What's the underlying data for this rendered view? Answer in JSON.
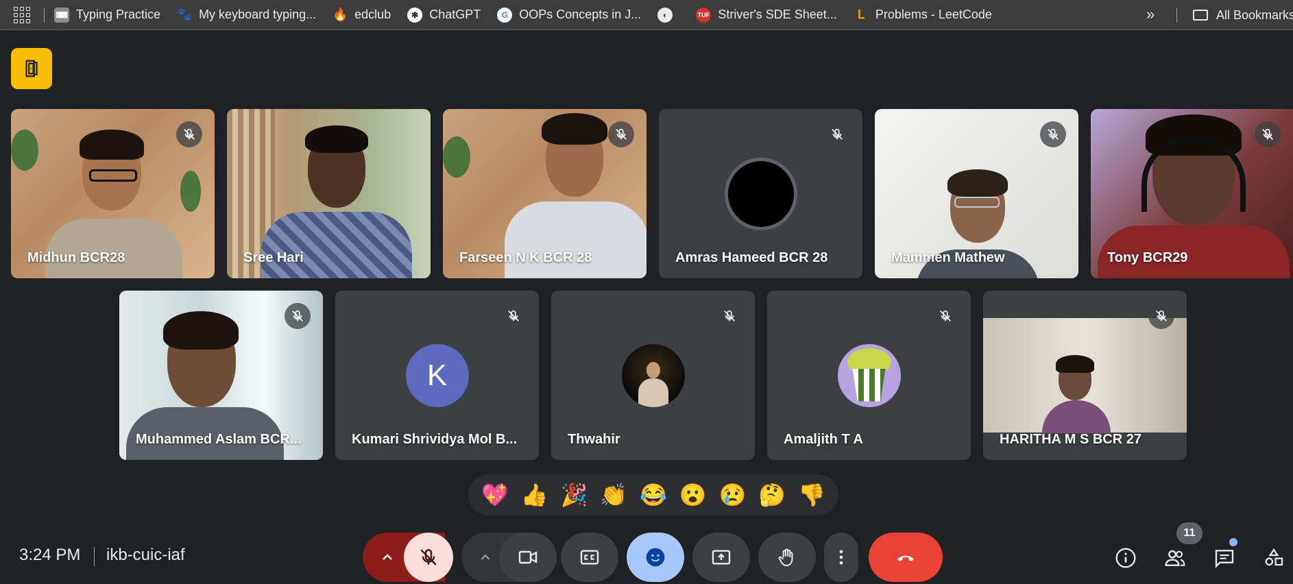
{
  "bookmarks": {
    "items": [
      {
        "label": "Typing Practice",
        "icon": "keyboard-icon",
        "color": "#8d8d8d"
      },
      {
        "label": "My keyboard typing...",
        "icon": "paw-icon",
        "color": "#1f1f1f"
      },
      {
        "label": "edclub",
        "icon": "flame-icon",
        "color": "#f4511e"
      },
      {
        "label": "ChatGPT",
        "icon": "chatgpt-icon",
        "color": "#ffffff"
      },
      {
        "label": "OOPs Concepts in J...",
        "icon": "google-icon",
        "color": "#4285f4"
      },
      {
        "label": "",
        "icon": "globe-icon",
        "color": "#e8eaed"
      },
      {
        "label": "Striver's SDE Sheet...",
        "icon": "tuf-icon",
        "color": "#d93025"
      },
      {
        "label": "Problems - LeetCode",
        "icon": "leetcode-icon",
        "color": "#f89f1b"
      }
    ],
    "more": "»",
    "all_bookmarks": "All Bookmarks"
  },
  "participants": [
    {
      "name": "Midhun BCR28",
      "type": "video"
    },
    {
      "name": "Sree Hari",
      "type": "video"
    },
    {
      "name": "Farseen N K BCR 28",
      "type": "video"
    },
    {
      "name": "Amras Hameed BCR 28",
      "type": "avatar"
    },
    {
      "name": "Mammen Mathew",
      "type": "video"
    },
    {
      "name": "Tony BCR29",
      "type": "video"
    },
    {
      "name": "Muhammed Aslam BCR...",
      "type": "video"
    },
    {
      "name": "Kumari Shrividya Mol B...",
      "type": "letter",
      "letter": "K",
      "color": "#5c6bc0"
    },
    {
      "name": "Thwahir",
      "type": "photo"
    },
    {
      "name": "Amaljith T A",
      "type": "photo"
    },
    {
      "name": "HARITHA M S BCR 27",
      "type": "video"
    }
  ],
  "reactions": [
    "💖",
    "👍",
    "🎉",
    "👏",
    "😂",
    "😮",
    "😢",
    "🤔",
    "👎"
  ],
  "footer": {
    "time": "3:24 PM",
    "meeting_code": "ikb-cuic-iaf",
    "participant_count": "11"
  },
  "colors": {
    "accent_yellow": "#fbbc04",
    "end_call_red": "#ea4335",
    "reaction_blue": "#8ab4f8",
    "mic_off_bg": "#f9dedc"
  }
}
